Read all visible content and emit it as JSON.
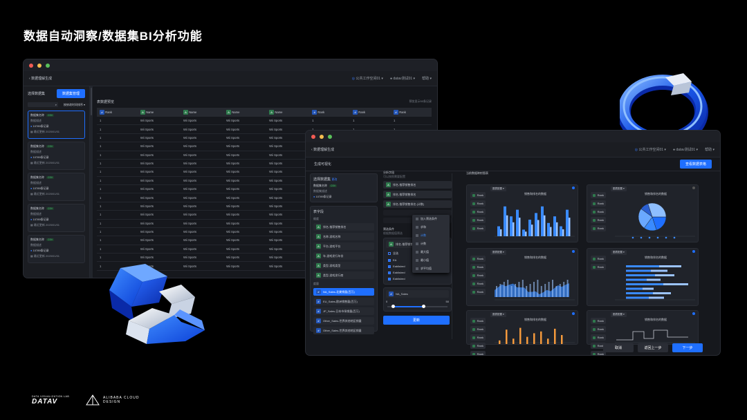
{
  "page_title": "数据自动洞察/数据集BI分析功能",
  "back_window": {
    "header_title": "数据理解生成",
    "workspace": "公共工作空间01",
    "user": "datav测试01",
    "help": "帮助",
    "select_dataset": "选择数据集",
    "manage_button": "数据集管理",
    "sort_label": "按修改时间排序",
    "preview_title": "表数据预览",
    "preview_note": "预览显示50条记录",
    "datasets": [
      {
        "name": "数据集名称",
        "tag": "CSV",
        "desc": "数据描述",
        "records": "10789条记录",
        "updated": "最近更新 2020/01/01"
      },
      {
        "name": "数据集名称",
        "tag": "CSV",
        "desc": "数据描述",
        "records": "10789条记录",
        "updated": "最近更新 2020/01/01"
      },
      {
        "name": "数据集名称",
        "tag": "CSV",
        "desc": "数据描述",
        "records": "10789条记录",
        "updated": "最近更新 2020/01/01"
      },
      {
        "name": "数据集名称",
        "tag": "CSV",
        "desc": "数据描述",
        "records": "10789条记录",
        "updated": "最近更新 2020/01/01"
      },
      {
        "name": "数据集名称",
        "tag": "CSV",
        "desc": "数据描述",
        "records": "10789条记录",
        "updated": "最近更新 2020/01/01"
      }
    ],
    "columns": [
      "Rank",
      "Name",
      "Name",
      "Name",
      "Name",
      "Rank",
      "Rank",
      "Rank"
    ],
    "row_values": [
      "1",
      "Wii Sports",
      "Wii Sports",
      "Wii Sports",
      "Wii Sports",
      "1",
      "1",
      "1"
    ],
    "row_count": 18
  },
  "front_window": {
    "header_title": "数据理解生成",
    "workspace": "公共工作空间01",
    "user": "datav测试01",
    "help": "帮助",
    "section": "生成可视化",
    "view_dataset_button": "查看数据表格",
    "select_dataset": "选择数据集",
    "change": "更改",
    "dataset_name": "数据集名称",
    "dataset_tag": "CSV",
    "dataset_desc": "数据集描述",
    "dataset_records": "10789条记录",
    "table_fields": "表字段",
    "dimensions": "维度",
    "dimension_fields": [
      "排名-推荐销售排名",
      "名称-游戏名称",
      "平台-游戏平台",
      "年-游戏发行年份",
      "类型-游戏类型",
      "类型-游戏发行商"
    ],
    "measures": "度量",
    "measure_fields": [
      "NA_Sales-北美销量(百万)",
      "EU_Sales-欧洲销售量(百万)",
      "JP_Sales-日本市场销量(百万)",
      "Other_Sales-世界其他地区销量",
      "Other_Sales-世界其他地区销量"
    ],
    "analysis_fields": "分析字段",
    "analysis_hint": "可以按照需要配置",
    "analysis_items": [
      "排名-推荐销售排名",
      "排名-推荐销售排名",
      "排名-推荐销售排名 (计数)"
    ],
    "context_menu": [
      "加入筛选条件",
      "求和",
      "计数",
      "计数",
      "最大值",
      "最小值",
      "求平均值"
    ],
    "filter_title": "筛选条件",
    "filter_hint": "根据数据值筛选",
    "filter_field": "排名-推荐销售排名",
    "filter_options": [
      "全选",
      "EA",
      "Eablished",
      "Eablished",
      "Eablished"
    ],
    "slider_field": "NA_Sales",
    "slider_min": "0",
    "slider_max": "50",
    "update_button": "更新",
    "charts_title": "当前数据映射图表",
    "chart_subtitle": "销售和排名的数据",
    "chart_tag": "图表配置",
    "legend_labels": [
      "Rank",
      "Rank",
      "Rank",
      "Rank",
      "Rank"
    ],
    "cancel": "取消",
    "prev": "返回上一步",
    "next": "下一步"
  },
  "footer": {
    "datav_small": "DATA VISUALIZATION LAB",
    "datav": "DATAV",
    "alibaba": "ALIBABA CLOUD",
    "design": "DESIGN"
  },
  "colors": {
    "accent": "#1f6fff",
    "background": "#000000",
    "panel": "#16181d",
    "chart_blue": "#3a8bff",
    "chart_orange": "#f59a3c",
    "green_tag": "#4bc37a"
  }
}
